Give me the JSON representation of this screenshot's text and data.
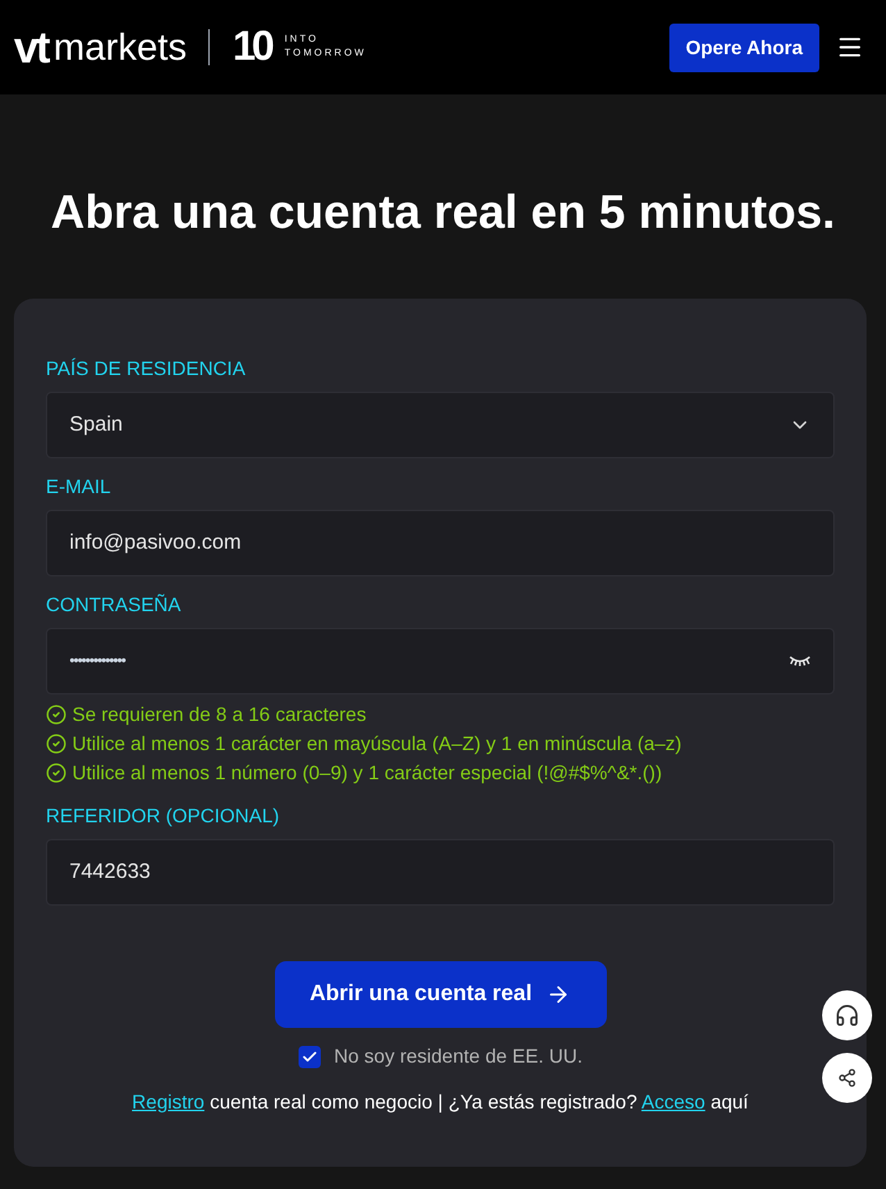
{
  "header": {
    "logo": {
      "brand": "vt",
      "name": "markets",
      "number": "10",
      "tagline_1": "INTO",
      "tagline_2": "TOMORROW"
    },
    "cta": "Opere Ahora"
  },
  "title": "Abra una cuenta real en 5 minutos.",
  "form": {
    "fields": [
      {
        "kind": "select",
        "label": "PAÍS DE RESIDENCIA",
        "value": "Spain"
      },
      {
        "kind": "text",
        "label": "E-MAIL",
        "value": "info@pasivoo.com"
      },
      {
        "kind": "password",
        "label": "CONTRASEÑA",
        "value": "••••••••••••••"
      },
      {
        "kind": "text",
        "label": "REFERIDOR (OPCIONAL)",
        "value": "7442633"
      }
    ],
    "rules": [
      {
        "text": "Se requieren de 8 a 16 caracteres",
        "checked": true
      },
      {
        "text": "Utilice al menos 1 carácter en mayúscula (A–Z) y 1 en minúscula (a–z)",
        "checked": true
      },
      {
        "text": "Utilice al menos 1 número (0–9) y 1 carácter especial (!@#$%^&*.())",
        "checked": true
      }
    ],
    "submit": "Abrir una cuenta real",
    "us_check": {
      "label": "No soy residente de EE. UU.",
      "checked": true
    },
    "footer": {
      "link_1": "Registro",
      "text_1": "cuenta real como negocio | ¿Ya estás registrado?",
      "link_2": "Acceso",
      "text_2": "aquí"
    }
  }
}
